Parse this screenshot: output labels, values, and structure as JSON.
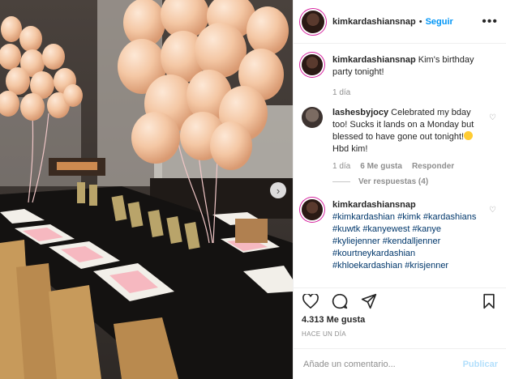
{
  "post": {
    "username": "kimkardashiansnap",
    "separator": "•",
    "follow_label": "Seguir",
    "more_label": "•••"
  },
  "comments": [
    {
      "username": "kimkardashiansnap",
      "text": "Kim's birthday party tonight!",
      "time": "1 día"
    },
    {
      "username": "lashesbyjocy",
      "text": "Celebrated my bday too! Sucks it lands on a Monday but blessed to have gone out tonight!",
      "text_after_emoji": " Hbd kim!",
      "time": "1 día",
      "likes": "6 Me gusta",
      "reply": "Responder",
      "view_replies": "Ver respuestas (4)"
    },
    {
      "username": "kimkardashiansnap",
      "hashtags": [
        "#kimkardashian",
        "#kimk",
        "#kardashians",
        "#kuwtk",
        "#kanyewest",
        "#kanye",
        "#kyliejenner",
        "#kendalljenner",
        "#kourtneykardashian",
        "#khloekardashian",
        "#krisjenner"
      ]
    }
  ],
  "actions": {
    "like_icon": "heart-outline-icon",
    "comment_icon": "comment-bubble-icon",
    "share_icon": "paper-plane-icon",
    "save_icon": "bookmark-icon"
  },
  "likes_count": "4.313 Me gusta",
  "timestamp": "HACE UN DÍA",
  "add_comment": {
    "placeholder": "Añade un comentario...",
    "publish_label": "Publicar"
  },
  "colors": {
    "accent": "#0095f6",
    "publish_disabled": "#b2dffc",
    "muted": "#8e8e8e",
    "balloon": "#f3c9a8"
  }
}
